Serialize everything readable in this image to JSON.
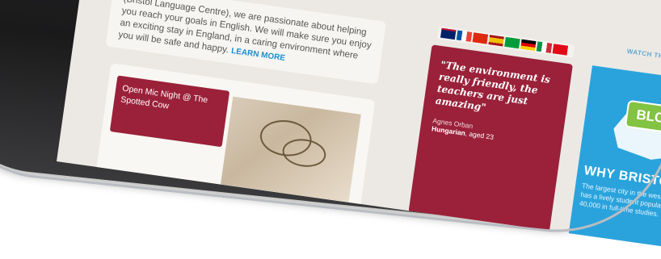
{
  "intro": {
    "text": "(Bristol Language Centre), we are passionate about helping you reach your goals in English. We will make sure you enjoy an exciting stay in England, in a caring environment where you will be safe and happy.",
    "learn_more": "LEARN MORE"
  },
  "event": {
    "title": "Open Mic Night @ The Spotted Cow"
  },
  "quote": {
    "text": "\"The environment is really friendly, the teachers are just amazing\"",
    "name": "Agnes Orban",
    "nationality": "Hungarian",
    "age": ", aged 23"
  },
  "map": {
    "logo": "BLC",
    "heading": "WHY BRISTOL",
    "body": "The largest city in the west of England, Bristol has a lively student population with almost 40,000 in full-time studies."
  },
  "watch": "WATCH THE VI",
  "colors": {
    "maroon": "#9a2139",
    "blue": "#2aa3dd",
    "green": "#82c341"
  },
  "flags": [
    "uk-flag",
    "china-flag",
    "spain-flag",
    "brazil-flag",
    "germany-flag",
    "italy-flag",
    "turkey-flag"
  ]
}
